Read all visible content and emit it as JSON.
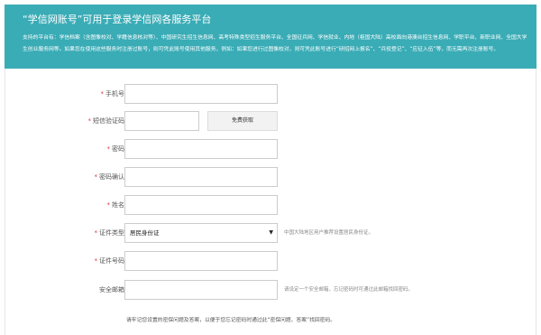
{
  "banner": {
    "title": "“学信网账号”可用于登录学信网各服务平台",
    "description": "支持的平台有：学信档案（含图像校对、学籍信息核对等）、中国研究生招生信息网、高考特殊类型招生服务平台、全国征兵网、学信就业、内地（祖国大陆）高校面向港澳台招生信息网、学职平台、新职业网、全国大学生创业服务网等。如果您在使用这些服务时注册过账号，则可凭此账号使用其他服务，例如：如果您进行过图像校对，则可凭此账号进行“研招网上报名”、“兵役登记”、“应征入伍”等，而无需再次注册账号。"
  },
  "form": {
    "required_mark": "*",
    "phone": {
      "label": "手机号",
      "value": ""
    },
    "sms_code": {
      "label": "短信验证码",
      "value": "",
      "button": "免费获取"
    },
    "password": {
      "label": "密码",
      "value": ""
    },
    "password_confirm": {
      "label": "密码确认",
      "value": ""
    },
    "name": {
      "label": "姓名",
      "value": ""
    },
    "id_type": {
      "label": "证件类型",
      "selected": "居民身份证",
      "arrow": "▼",
      "hint": "中国大陆地区用户推荐设置居民身份证。"
    },
    "id_number": {
      "label": "证件号码",
      "value": ""
    },
    "security_email": {
      "label": "安全邮箱",
      "value": "",
      "hint": "请设定一个安全邮箱，忘记密码时可通过此邮箱找回密码。"
    },
    "footer_note": "请牢记您设置的密保问题及答案，以便于您忘记密码时通过此“密保问题、答案”找回密码。"
  }
}
